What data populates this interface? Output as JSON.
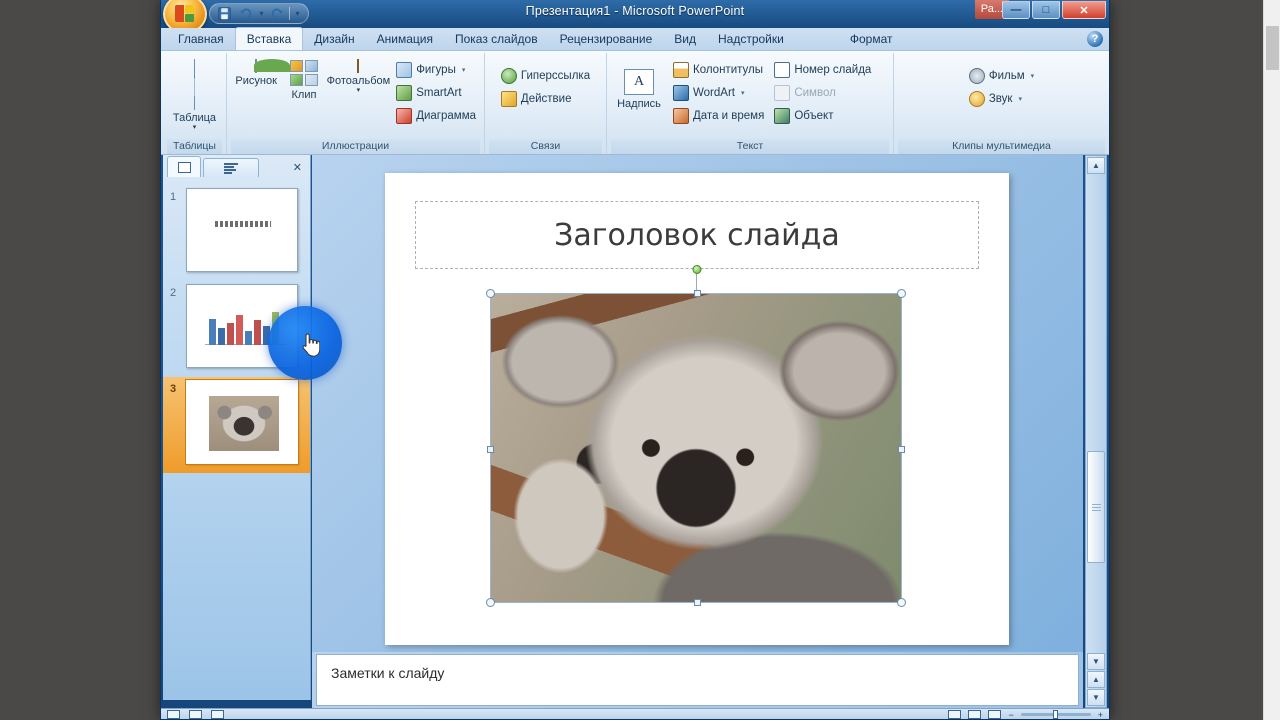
{
  "window": {
    "title": "Презентация1 - Microsoft PowerPoint",
    "badge": "Ра...",
    "minimize": "—",
    "maximize": "□",
    "close": "✕"
  },
  "quick_access": {
    "save_icon": "save-icon",
    "undo_icon": "undo-icon",
    "undo_caret": "▾",
    "redo_icon": "redo-icon",
    "customize_caret": "▾"
  },
  "office_button": {
    "name": "office-button"
  },
  "ribbon": {
    "help_label": "?",
    "tabs": [
      {
        "label": "Главная",
        "active": false
      },
      {
        "label": "Вставка",
        "active": true
      },
      {
        "label": "Дизайн",
        "active": false
      },
      {
        "label": "Анимация",
        "active": false
      },
      {
        "label": "Показ слайдов",
        "active": false
      },
      {
        "label": "Рецензирование",
        "active": false
      },
      {
        "label": "Вид",
        "active": false
      },
      {
        "label": "Надстройки",
        "active": false
      },
      {
        "label": "Формат",
        "active": false
      }
    ],
    "groups": {
      "tables": {
        "title": "Таблицы",
        "table_label": "Таблица",
        "caret": "▾"
      },
      "illustrations": {
        "title": "Иллюстрации",
        "picture_label": "Рисунок",
        "clip_label": "Клип",
        "photoalbum_label": "Фотоальбом",
        "photoalbum_caret": "▾",
        "shapes_label": "Фигуры",
        "shapes_caret": "▾",
        "smartart_label": "SmartArt",
        "chart_label": "Диаграмма"
      },
      "links": {
        "title": "Связи",
        "hyperlink_label": "Гиперссылка",
        "action_label": "Действие"
      },
      "text": {
        "title": "Текст",
        "textbox_label": "Надпись",
        "headerfooter_label": "Колонтитулы",
        "wordart_label": "WordArt",
        "wordart_caret": "▾",
        "datetime_label": "Дата и время",
        "slidenumber_label": "Номер слайда",
        "symbol_label": "Символ",
        "object_label": "Объект"
      },
      "media": {
        "title": "Клипы мультимедиа",
        "movie_label": "Фильм",
        "movie_caret": "▾",
        "sound_label": "Звук",
        "sound_caret": "▾"
      }
    }
  },
  "thumbnail_pane": {
    "tab_slides": "slides-tab-icon",
    "tab_outline": "outline-tab-icon",
    "close_label": "✕",
    "slides": [
      {
        "number": "1",
        "kind": "title",
        "selected": false
      },
      {
        "number": "2",
        "kind": "chart",
        "selected": false
      },
      {
        "number": "3",
        "kind": "picture",
        "selected": true
      }
    ]
  },
  "slide": {
    "title_text": "Заголовок слайда",
    "picture_name": "koala-photo"
  },
  "notes": {
    "placeholder_text": "Заметки к слайду"
  },
  "scrollbar": {
    "up_arrow": "▲",
    "down_arrow": "▼",
    "prev_slide": "▲",
    "next_slide": "▼"
  },
  "statusbar": {
    "zoom_minus": "−",
    "zoom_plus": "+"
  },
  "colors": {
    "accent_blue": "#0a63e0",
    "selection_orange": "#ef9c2a",
    "ribbon_bg": "#e4eef8",
    "title_bar": "#235d97",
    "desktop": "#4a4947"
  },
  "cursor": {
    "type": "hand-pointer",
    "highlight": "click-highlight"
  }
}
